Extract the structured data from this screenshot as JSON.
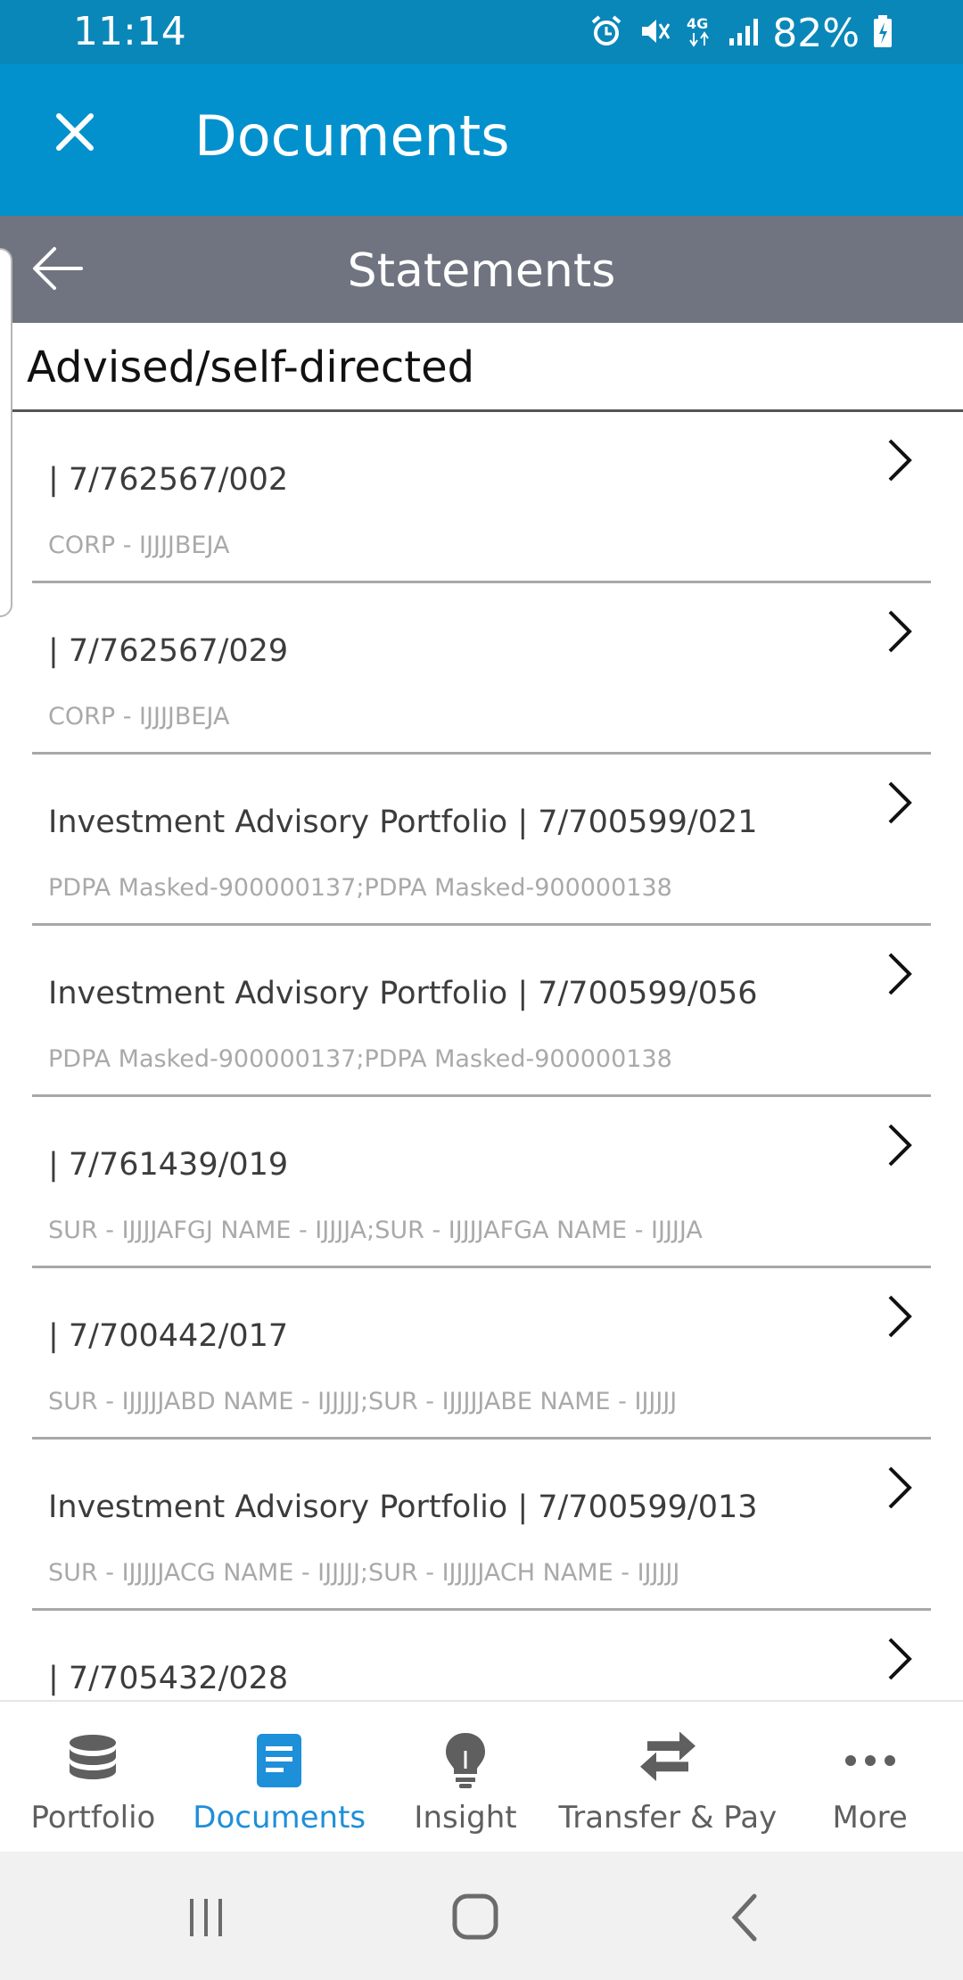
{
  "status_bar": {
    "time": "11:14",
    "battery": "82%",
    "network": "4G",
    "icons": [
      "alarm-icon",
      "mute-icon",
      "network-4g-icon",
      "signal-icon",
      "battery-charging-icon"
    ]
  },
  "header": {
    "title": "Documents",
    "close_icon": "close-icon"
  },
  "sub_header": {
    "title": "Statements",
    "back_icon": "back-arrow-icon"
  },
  "section": {
    "heading": "Advised/self-directed"
  },
  "statements": [
    {
      "title": "| 7/762567/002",
      "subtitle": "CORP - IJJJJBEJA"
    },
    {
      "title": "| 7/762567/029",
      "subtitle": "CORP - IJJJJBEJA"
    },
    {
      "title": "Investment Advisory Portfolio | 7/700599/021",
      "subtitle": "PDPA Masked-900000137;PDPA Masked-900000138"
    },
    {
      "title": "Investment Advisory Portfolio | 7/700599/056",
      "subtitle": "PDPA Masked-900000137;PDPA Masked-900000138"
    },
    {
      "title": "| 7/761439/019",
      "subtitle": "SUR - IJJJJAFGJ NAME - IJJJJA;SUR - IJJJJAFGA NAME - IJJJJA"
    },
    {
      "title": "| 7/700442/017",
      "subtitle": "SUR - IJJJJJABD NAME - IJJJJJ;SUR - IJJJJJABE NAME - IJJJJJ"
    },
    {
      "title": "Investment Advisory Portfolio | 7/700599/013",
      "subtitle": "SUR - IJJJJJACG NAME - IJJJJJ;SUR - IJJJJJACH NAME - IJJJJJ"
    },
    {
      "title": "| 7/705432/028",
      "subtitle": ""
    }
  ],
  "bottom_nav": [
    {
      "label": "Portfolio",
      "icon": "database-icon",
      "active": false
    },
    {
      "label": "Documents",
      "icon": "document-icon",
      "active": true
    },
    {
      "label": "Insight",
      "icon": "lightbulb-icon",
      "active": false
    },
    {
      "label": "Transfer & Pay",
      "icon": "transfer-arrows-icon",
      "active": false
    },
    {
      "label": "More",
      "icon": "more-dots-icon",
      "active": false
    }
  ],
  "colors": {
    "status_bar": "#0a87b9",
    "header": "#0391cd",
    "sub_header": "#6f7480",
    "active_nav": "#1e8fd9",
    "inactive_nav": "#5f5f5f"
  }
}
